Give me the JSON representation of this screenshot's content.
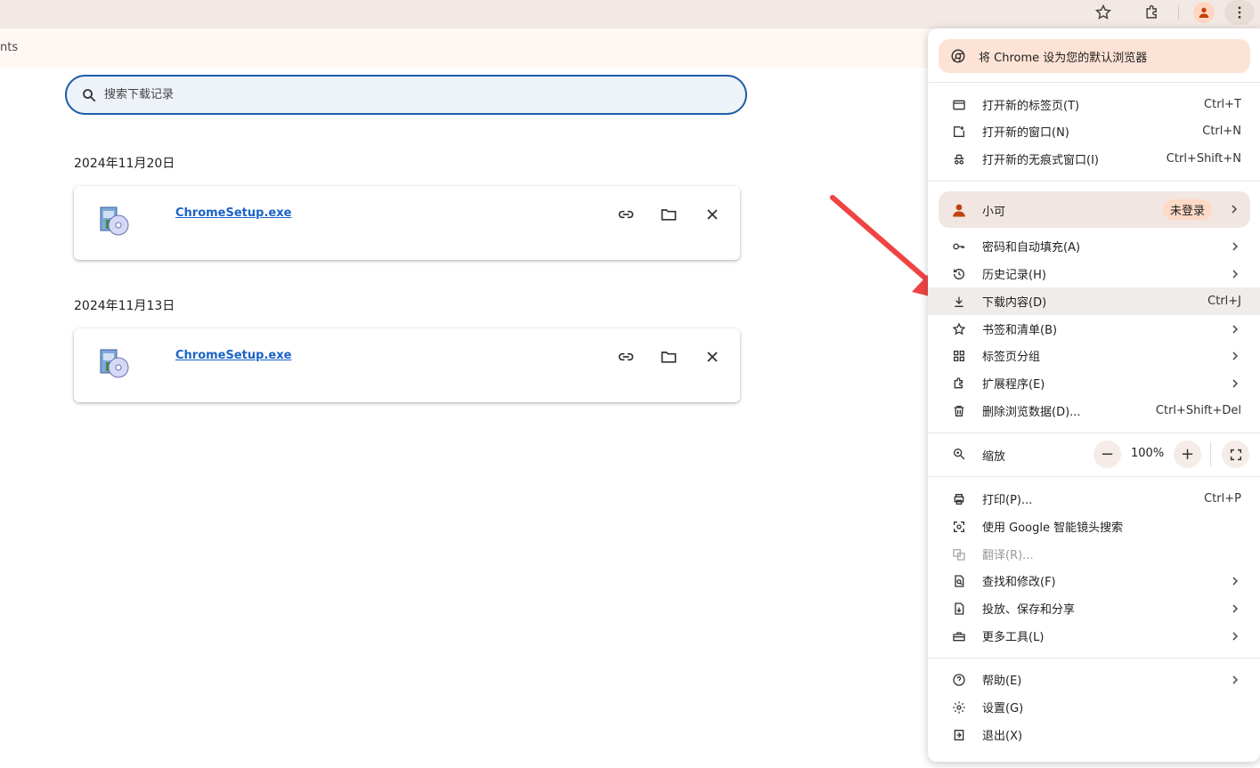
{
  "subbar": {
    "partial_text": "nts"
  },
  "search": {
    "placeholder": "搜索下载记录"
  },
  "groups": [
    {
      "date": "2024年11月20日",
      "file": "ChromeSetup.exe"
    },
    {
      "date": "2024年11月13日",
      "file": "ChromeSetup.exe"
    }
  ],
  "menu": {
    "default_banner": "将 Chrome 设为您的默认浏览器",
    "section1": [
      {
        "label": "打开新的标签页(T)",
        "shortcut": "Ctrl+T"
      },
      {
        "label": "打开新的窗口(N)",
        "shortcut": "Ctrl+N"
      },
      {
        "label": "打开新的无痕式窗口(I)",
        "shortcut": "Ctrl+Shift+N"
      }
    ],
    "profile": {
      "name": "小可",
      "status": "未登录"
    },
    "section2": [
      {
        "label": "密码和自动填充(A)"
      },
      {
        "label": "历史记录(H)"
      },
      {
        "label": "下载内容(D)",
        "shortcut": "Ctrl+J"
      },
      {
        "label": "书签和清单(B)"
      },
      {
        "label": "标签页分组"
      },
      {
        "label": "扩展程序(E)"
      },
      {
        "label": "删除浏览数据(D)...",
        "shortcut": "Ctrl+Shift+Del"
      }
    ],
    "zoom": {
      "label": "缩放",
      "minus": "−",
      "value": "100%",
      "plus": "+"
    },
    "section3": [
      {
        "label": "打印(P)...",
        "shortcut": "Ctrl+P"
      },
      {
        "label": "使用 Google 智能镜头搜索"
      },
      {
        "label": "翻译(R)..."
      },
      {
        "label": "查找和修改(F)"
      },
      {
        "label": "投放、保存和分享"
      },
      {
        "label": "更多工具(L)"
      }
    ],
    "section4": [
      {
        "label": "帮助(E)"
      },
      {
        "label": "设置(G)"
      },
      {
        "label": "退出(X)"
      }
    ]
  },
  "colors": {
    "accent": "#1f5ea8",
    "link": "#1a63c7",
    "banner": "#fde3d5",
    "arrow": "#ef4444"
  }
}
